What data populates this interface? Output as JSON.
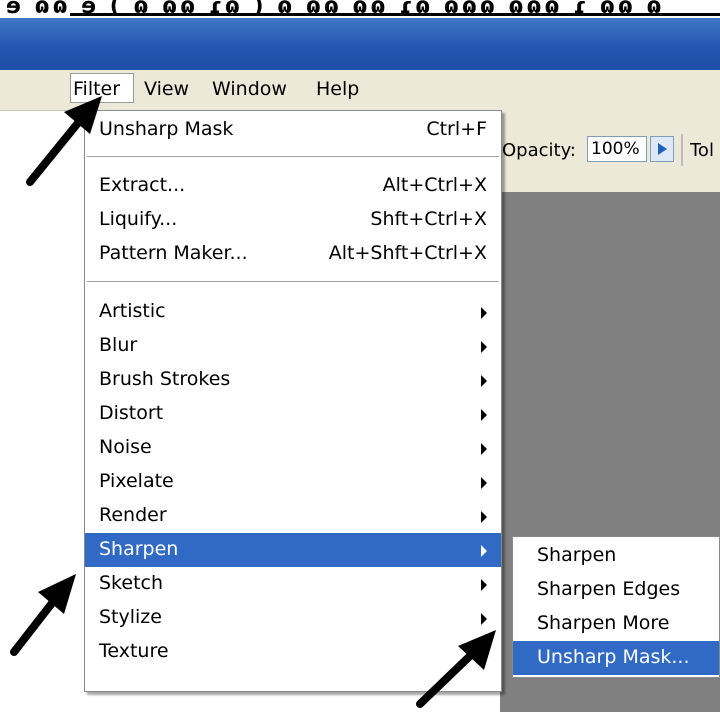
{
  "top_strip": {
    "text": "ɘ ɷɷ ɘ ( ɷ ɷɷ ɾɷ ) ɷ ɷɷ ɷɷ ɾɷ ɷɷɷ ɷɷɷ ɾ ɷɷ ɷ"
  },
  "menubar": [
    {
      "label": "Filter"
    },
    {
      "label": "View"
    },
    {
      "label": "Window"
    },
    {
      "label": "Help"
    }
  ],
  "options_bar": {
    "opacity_label": "Opacity:",
    "opacity_value": "100%",
    "tolerance_label": "Tol"
  },
  "filter_menu": {
    "last_filter": {
      "label": "Unsharp Mask",
      "shortcut": "Ctrl+F"
    },
    "group1": [
      {
        "label": "Extract...",
        "shortcut": "Alt+Ctrl+X"
      },
      {
        "label": "Liquify...",
        "shortcut": "Shft+Ctrl+X"
      },
      {
        "label": "Pattern Maker...",
        "shortcut": "Alt+Shft+Ctrl+X"
      }
    ],
    "categories": [
      {
        "label": "Artistic"
      },
      {
        "label": "Blur"
      },
      {
        "label": "Brush Strokes"
      },
      {
        "label": "Distort"
      },
      {
        "label": "Noise"
      },
      {
        "label": "Pixelate"
      },
      {
        "label": "Render"
      },
      {
        "label": "Sharpen",
        "highlighted": true
      },
      {
        "label": "Sketch"
      },
      {
        "label": "Stylize"
      },
      {
        "label": "Texture"
      }
    ]
  },
  "sharpen_submenu": [
    {
      "label": "Sharpen"
    },
    {
      "label": "Sharpen Edges"
    },
    {
      "label": "Sharpen More"
    },
    {
      "label": "Unsharp Mask...",
      "highlighted": true
    }
  ],
  "colors": {
    "highlight": "#316ac5",
    "title_bar": "#2457b0",
    "menu_bg": "#ece9d8",
    "canvas": "#808080"
  },
  "annotations": {
    "pointer_arrows": 3
  }
}
